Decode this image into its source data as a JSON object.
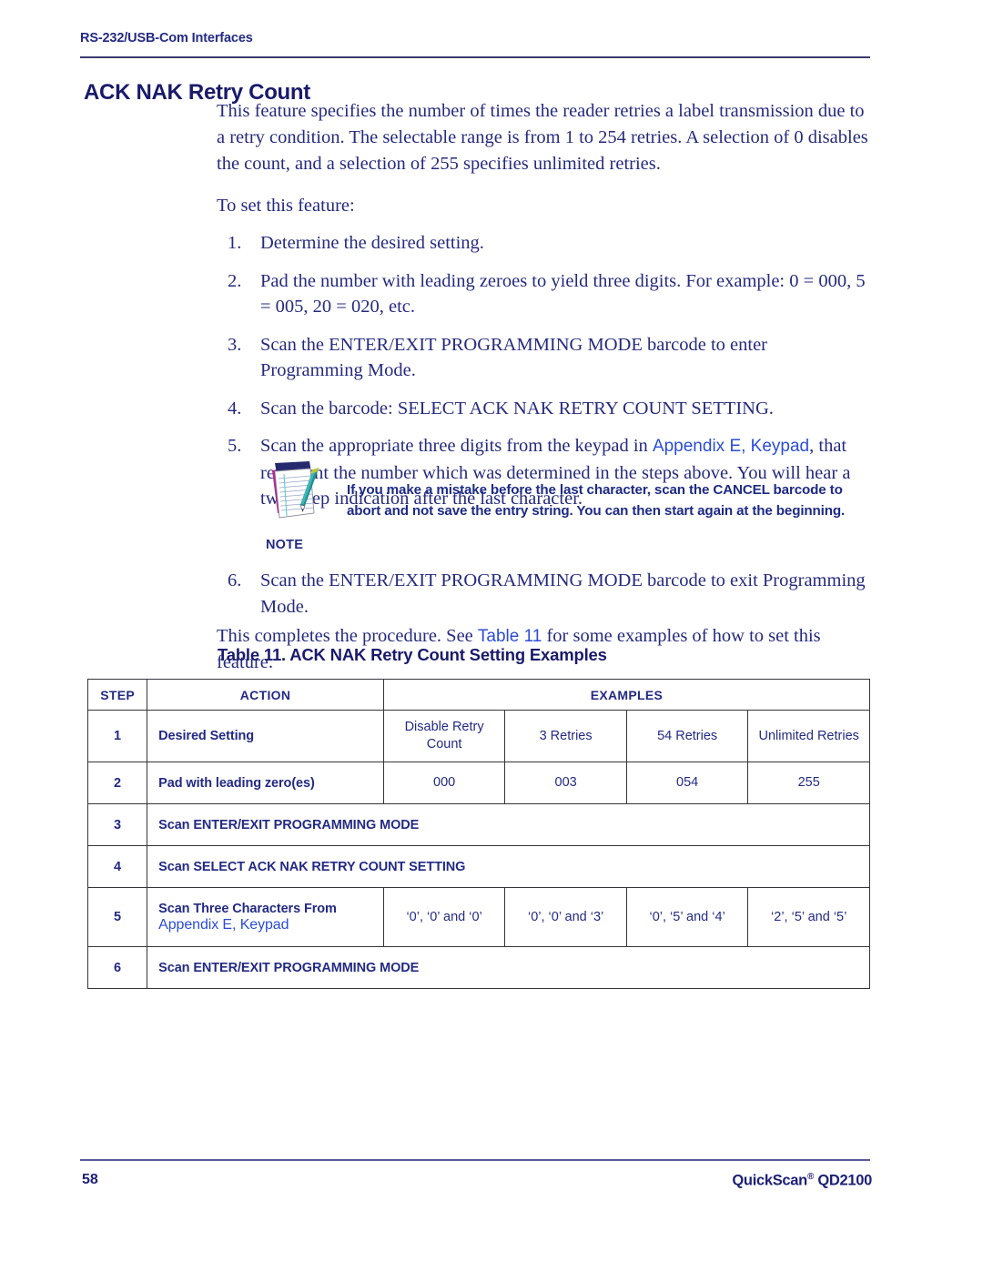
{
  "header": {
    "running_header": "RS-232/USB-Com Interfaces",
    "section_title": "ACK NAK Retry Count"
  },
  "body": {
    "intro": "This feature specifies the number of times the reader retries a label transmission due to a retry condition. The selectable range is from 1 to 254 retries. A selection of 0 disables the count, and a selection of 255 specifies unlimited retries.",
    "to_set": "To set this feature:",
    "steps": [
      {
        "num": "1.",
        "text": "Determine the desired setting."
      },
      {
        "num": "2.",
        "text": "Pad the number with leading zeroes to yield three digits. For example: 0 = 000, 5 = 005, 20 = 020, etc."
      },
      {
        "num": "3.",
        "text": "Scan the ENTER/EXIT PROGRAMMING MODE barcode to enter Programming Mode."
      },
      {
        "num": "4.",
        "text": "Scan the barcode: SELECT ACK NAK RETRY COUNT SETTING."
      },
      {
        "num": "5.",
        "text_before_link": "Scan the appropriate three digits from the keypad in ",
        "link": "Appendix E, Keypad",
        "text_after_link": ", that represent the number which was determined in the steps above. You will hear a two-beep indication after the last character."
      },
      {
        "num": "6.",
        "text": "Scan the ENTER/EXIT PROGRAMMING MODE barcode to exit Programming Mode."
      }
    ],
    "closing_before_link": "This completes the procedure. See ",
    "closing_link": "Table 11",
    "closing_after_link": " for some examples of how to set this feature."
  },
  "note": {
    "icon": "notepad-pen-icon",
    "label": "NOTE",
    "text": "If you make a mistake before the last character, scan the CANCEL barcode to abort and not save the entry string. You can then start again at the beginning."
  },
  "table": {
    "caption": "Table 11. ACK NAK Retry Count Setting Examples",
    "headers": [
      "STEP",
      "ACTION",
      "EXAMPLES"
    ],
    "rows": [
      {
        "step": "1",
        "action": "Desired Setting",
        "action_link": null,
        "full_width": false,
        "examples": [
          "Disable Retry Count",
          "3 Retries",
          "54 Retries",
          "Unlimited Retries"
        ]
      },
      {
        "step": "2",
        "action": "Pad with leading zero(es)",
        "action_link": null,
        "full_width": false,
        "examples": [
          "000",
          "003",
          "054",
          "255"
        ]
      },
      {
        "step": "3",
        "action": "Scan ENTER/EXIT PROGRAMMING MODE",
        "action_link": null,
        "full_width": true,
        "examples": []
      },
      {
        "step": "4",
        "action": "Scan SELECT ACK NAK RETRY COUNT SETTING",
        "action_link": null,
        "full_width": true,
        "examples": []
      },
      {
        "step": "5",
        "action": "Scan Three Characters From",
        "action_link": "Appendix E, Keypad",
        "full_width": false,
        "examples": [
          "‘0’, ‘0’ and ‘0’",
          "‘0’, ‘0’ and ‘3’",
          "‘0’, ‘5’ and ‘4’",
          "‘2’, ‘5’ and ‘5’"
        ]
      },
      {
        "step": "6",
        "action": "Scan ENTER/EXIT PROGRAMMING MODE",
        "action_link": null,
        "full_width": true,
        "examples": []
      }
    ]
  },
  "footer": {
    "page_number": "58",
    "product_name": "QuickScan",
    "product_mark": "®",
    "product_model": " QD2100"
  },
  "colors": {
    "body_text": "#262a7e",
    "heading": "#191a6b",
    "link": "#2b4cd8",
    "rule": "#3a3a6e",
    "table_border": "#35353a"
  }
}
